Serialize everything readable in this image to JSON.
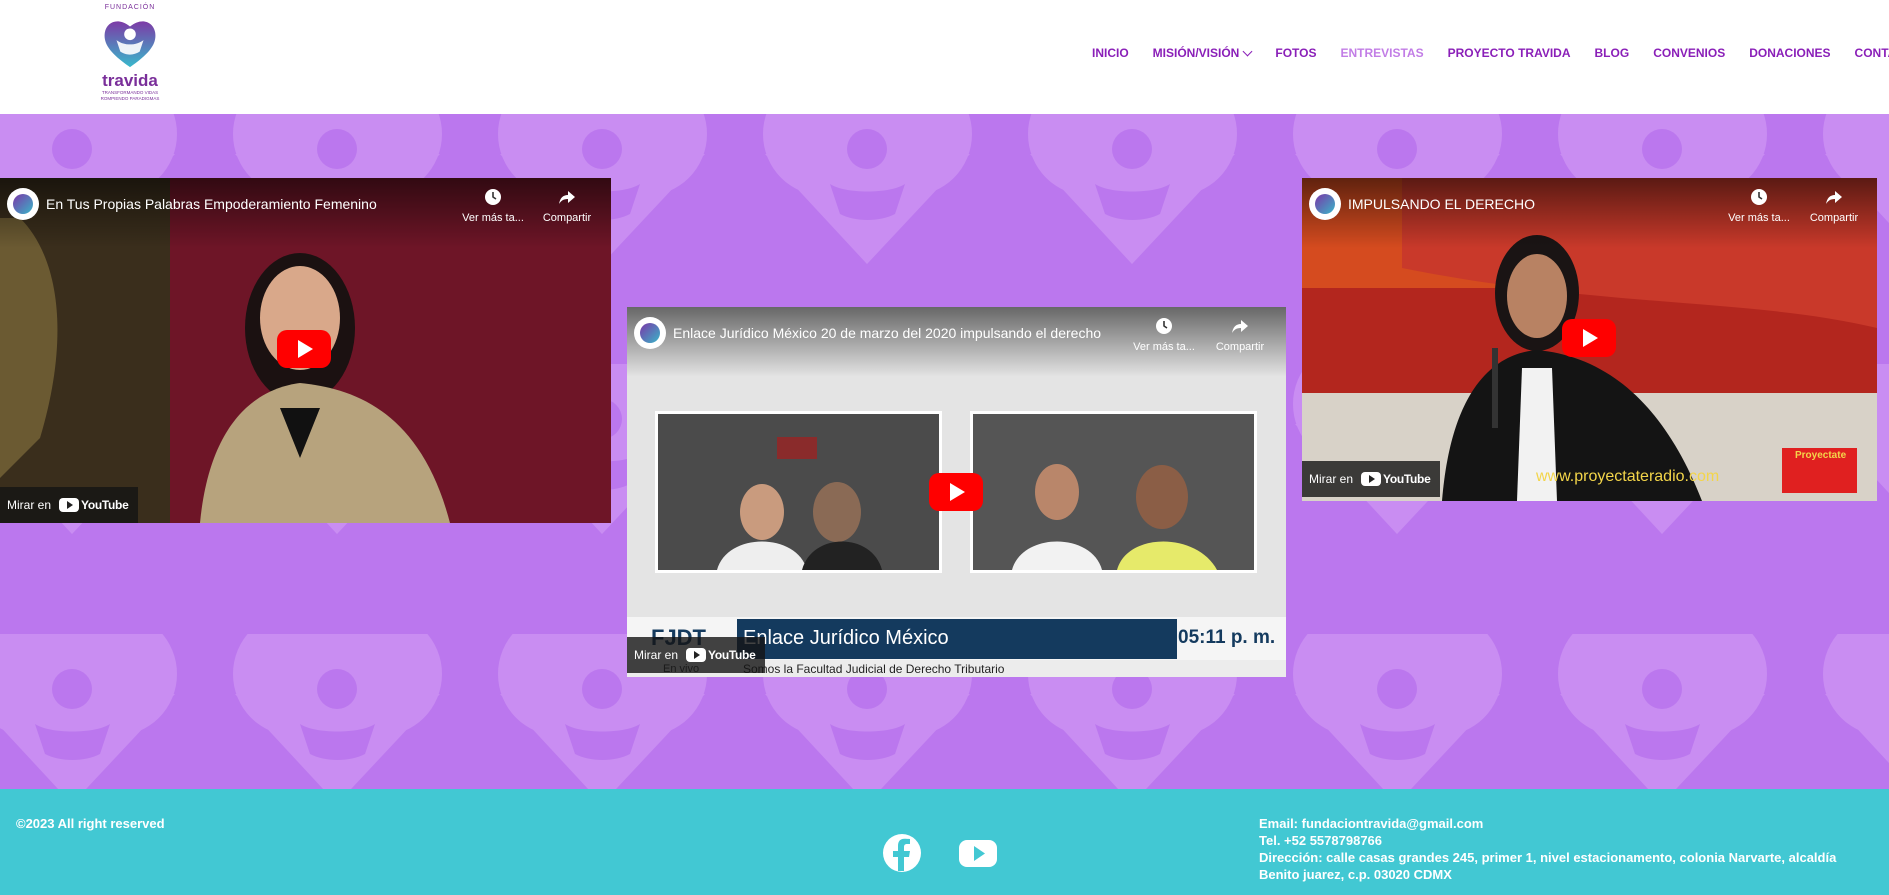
{
  "logo": {
    "top_text": "FUNDACIÓN",
    "name": "travida",
    "tagline_1": "TRANSFORMANDO VIDAS",
    "tagline_2": "ROMPIENDO PARADIGMAS"
  },
  "nav": {
    "items": [
      {
        "label": "INICIO"
      },
      {
        "label": "MISIÓN/VISIÓN"
      },
      {
        "label": "FOTOS"
      },
      {
        "label": "ENTREVISTAS"
      },
      {
        "label": "PROYECTO TRAVIDA"
      },
      {
        "label": "BLOG"
      },
      {
        "label": "CONVENIOS"
      },
      {
        "label": "DONACIONES"
      },
      {
        "label": "CONTACTO"
      }
    ],
    "active": "ENTREVISTAS"
  },
  "videos": [
    {
      "title": "En Tus Propias Palabras Empoderamiento Femenino",
      "watch_later": "Ver más ta...",
      "share": "Compartir",
      "watch_on": "Mirar en",
      "youtube": "YouTube"
    },
    {
      "title": "Enlace Jurídico México 20 de marzo del 2020 impulsando el derecho",
      "watch_later": "Ver más ta...",
      "share": "Compartir",
      "watch_on": "Mirar en",
      "youtube": "YouTube",
      "lower_third": {
        "left": "FJDT",
        "left_sub": "En vivo",
        "headline": "Enlace Jurídico México",
        "time": "05:11 p. m.",
        "ticker": "Somos la Facultad Judicial de Derecho Tributario"
      }
    },
    {
      "title": "IMPULSANDO EL DERECHO",
      "watch_later": "Ver más ta...",
      "share": "Compartir",
      "watch_on": "Mirar en",
      "youtube": "YouTube",
      "overlay_url": "www.proyectateradio.com",
      "overlay_brand": "Proyectate"
    }
  ],
  "footer": {
    "copyright": "©2023 All right reserved",
    "email": "Email: fundaciontravida@gmail.com",
    "tel": "Tel. +52 5578798766",
    "address_1": "Dirección: calle casas grandes 245, primer 1, nivel estacionamento, colonia Narvarte, alcaldía",
    "address_2": "Benito juarez, c.p. 03020 CDMX",
    "social_icons": [
      "facebook-icon",
      "youtube-icon"
    ]
  },
  "colors": {
    "nav_purple": "#8a1fb8",
    "nav_active": "#c27de6",
    "main_bg": "#bb77ee",
    "footer_bg": "#42c8d3",
    "youtube_red": "#ff0000"
  }
}
